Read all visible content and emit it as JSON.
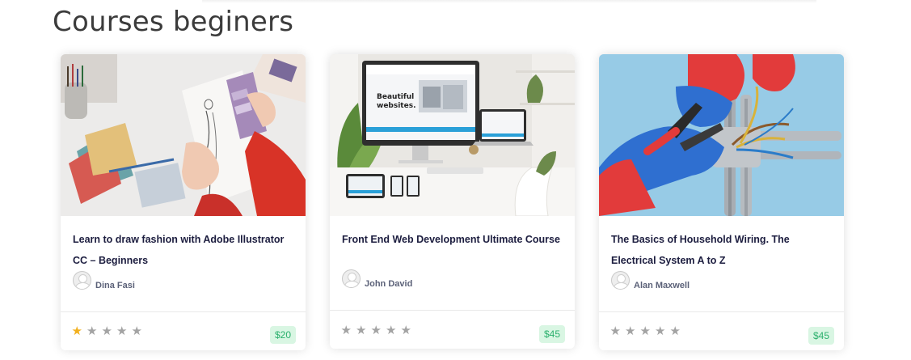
{
  "section": {
    "title": "Courses beginers"
  },
  "courses": [
    {
      "title": "Learn to draw fashion with Adobe Illustrator CC – Beginners",
      "author": "Dina Fasi",
      "rating": 1,
      "max_rating": 5,
      "price": "$20",
      "image": "fashion-sketch-photo"
    },
    {
      "title": "Front End Web Development Ultimate Course",
      "author": "John David",
      "rating": 0,
      "max_rating": 5,
      "price": "$45",
      "image": "web-devices-photo"
    },
    {
      "title": "The Basics of Household Wiring. The Electrical System A to Z",
      "author": "Alan Maxwell",
      "rating": 0,
      "max_rating": 5,
      "price": "$45",
      "image": "electrical-wiring-photo"
    }
  ],
  "colors": {
    "accent_green": "#2bb06d",
    "price_bg": "#d9f6e3",
    "star_filled": "#f2b01e",
    "star_empty": "#a3a3a3",
    "title": "#1c1d3f"
  },
  "icons": {
    "star": "star-icon",
    "avatar": "user-avatar-icon"
  }
}
